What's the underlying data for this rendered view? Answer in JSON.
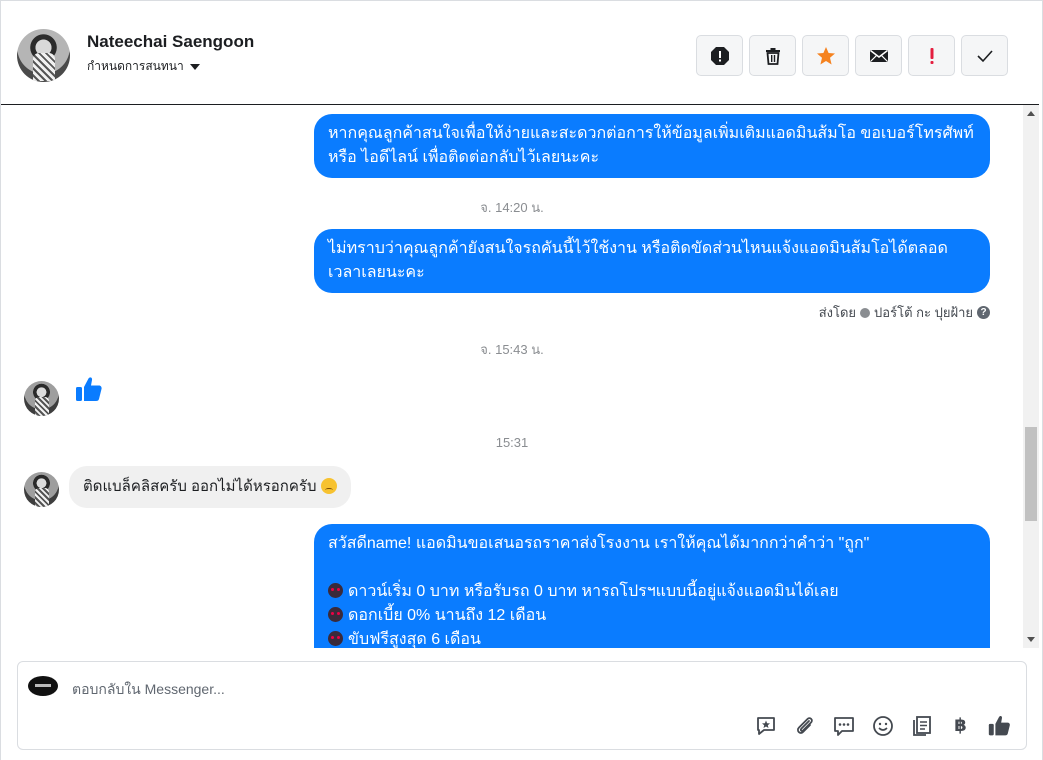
{
  "header": {
    "contact_name": "Nateechai Saengoon",
    "conversation_settings": "กำหนดการสนทนา",
    "actions": [
      {
        "name": "report-button",
        "icon": "alert-octagon-icon"
      },
      {
        "name": "delete-button",
        "icon": "trash-icon"
      },
      {
        "name": "star-button",
        "icon": "star-icon"
      },
      {
        "name": "mark-unread-button",
        "icon": "envelope-icon"
      },
      {
        "name": "important-button",
        "icon": "exclamation-icon"
      },
      {
        "name": "done-button",
        "icon": "check-icon"
      }
    ]
  },
  "messages": {
    "m1_text": "หากคุณลูกค้าสนใจเพื่อให้ง่ายและสะดวกต่อการให้ข้อมูลเพิ่มเติมแอดมินส้มโอ ขอเบอร์โทรศัพท์ หรือ ไอดีไลน์ เพื่อติดต่อกลับไว้เลยนะคะ",
    "ts1": "จ. 14:20 น.",
    "m2_text": "ไม่ทราบว่าคุณลูกค้ายังสนใจรถคันนี้ไว้ใช้งาน หรือติดขัดส่วนไหนแจ้งแอดมินส้มโอได้ตลอดเวลาเลยนะคะ",
    "sent_by_prefix": "ส่งโดย",
    "sent_by_name": "ปอร์โต้ กะ ปุยฝ้าย",
    "ts2": "จ. 15:43 น.",
    "ts3": "15:31",
    "m3_text": "ติดแบล็คลิสครับ ออกไม่ได้หรอกครับ",
    "m4_line1": "สวัสดีname! แอดมินขอเสนอรถราคาส่งโรงงาน เราให้คุณได้มากกว่าคำว่า \"ถูก\"",
    "m4_line2": "ดาวน์เริ่ม 0 บาท หรือรับรถ 0 บาท หารถโปรฯแบบนี้อยู่แจ้งแอดมินได้เลย",
    "m4_line3": "ดอกเบี้ย 0% นานถึง 12 เดือน",
    "m4_line4": "ขับฟรีสูงสุด 6 เดือน"
  },
  "composer": {
    "placeholder": "ตอบกลับใน Messenger...",
    "tools": [
      "saved-reply-icon",
      "attachment-icon",
      "chat-bubble-icon",
      "emoji-icon",
      "template-icon",
      "baht-icon",
      "thumbs-up-icon"
    ],
    "baht_symbol": "฿"
  },
  "colors": {
    "bubble_out": "#0a7cff",
    "bubble_in": "#f0f0f0",
    "star": "#f5821f",
    "important": "#e41e3f"
  }
}
